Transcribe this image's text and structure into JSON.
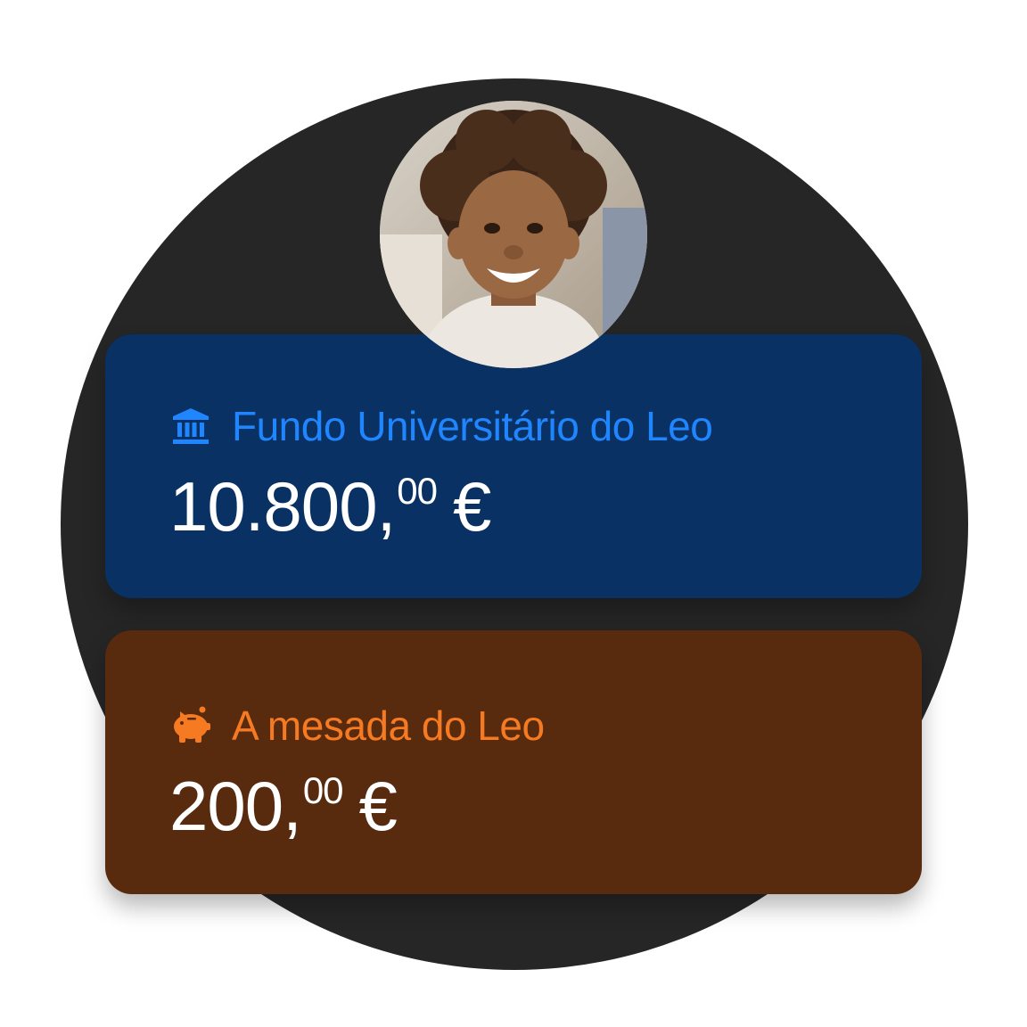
{
  "colors": {
    "background_circle": "#262626",
    "card_blue": "#093163",
    "card_blue_accent": "#1f86ff",
    "card_brown": "#582a0e",
    "card_brown_accent": "#f67a21",
    "amount_text": "#ffffff"
  },
  "profile": {
    "avatar": "child-photo"
  },
  "accounts": [
    {
      "icon": "bank-icon",
      "title": "Fundo Universitário do Leo",
      "amount_main": "10.800,",
      "amount_cents": "00",
      "currency": "€"
    },
    {
      "icon": "piggy-bank-icon",
      "title": "A mesada do Leo",
      "amount_main": "200,",
      "amount_cents": "00",
      "currency": "€"
    }
  ]
}
